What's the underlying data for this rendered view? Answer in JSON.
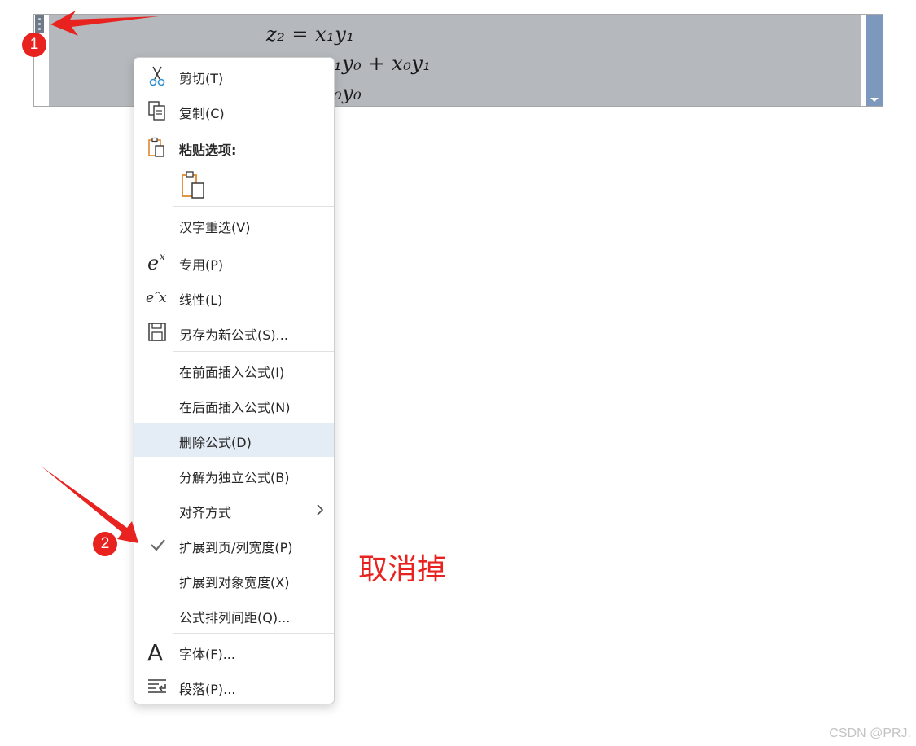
{
  "equation": {
    "line1": "z₂ = x₁y₁",
    "line2": "₁y₀ + x₀y₁",
    "line3": "₀y₀"
  },
  "menu": {
    "cut": "剪切(T)",
    "copy": "复制(C)",
    "paste_options": "粘贴选项:",
    "reconvert": "汉字重选(V)",
    "professional": "专用(P)",
    "linear": "线性(L)",
    "save_as_new_equation": "另存为新公式(S)...",
    "insert_before": "在前面插入公式(I)",
    "insert_after": "在后面插入公式(N)",
    "delete_equation": "删除公式(D)",
    "split_equation": "分解为独立公式(B)",
    "alignment": "对齐方式",
    "expand_page_width": "扩展到页/列宽度(P)",
    "expand_object_width": "扩展到对象宽度(X)",
    "equation_spacing": "公式排列间距(Q)...",
    "font": "字体(F)...",
    "paragraph": "段落(P)..."
  },
  "annotations": {
    "badge1": "1",
    "badge2": "2",
    "note": "取消掉",
    "arrow_color": "#e8231f"
  },
  "watermark": "CSDN @PRJ.",
  "icons": {
    "cut": "scissors-icon",
    "copy": "copy-icon",
    "paste_options": "clipboard-icon",
    "keep_text_only": "paste-clipboard-icon",
    "professional": "professional-format-icon",
    "linear": "linear-format-icon",
    "save": "save-icon",
    "alignment": "chevron-right-icon",
    "checkmark": "checkmark-icon",
    "font": "font-icon",
    "paragraph": "paragraph-icon"
  },
  "state": {
    "highlighted_item": "delete_equation",
    "expand_page_width_checked": true
  }
}
